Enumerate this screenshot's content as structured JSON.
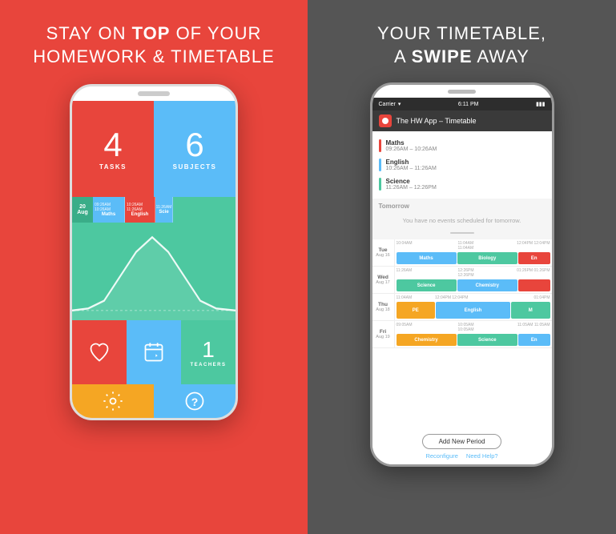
{
  "left": {
    "headline_line1": "STAY ON ",
    "headline_bold": "TOP",
    "headline_line2": " OF YOUR",
    "headline_line3": "HOMEWORK & TIMETABLE",
    "tasks_number": "4",
    "tasks_label": "TASKS",
    "subjects_number": "6",
    "subjects_label": "SUBJECTS",
    "timeline": {
      "date_day": "20",
      "date_month": "Aug",
      "items": [
        {
          "start": "09:26AM",
          "end": "10:26AM",
          "name": "Maths",
          "color": "maths"
        },
        {
          "start": "10:26AM",
          "end": "11:26AM",
          "name": "English",
          "color": "english"
        },
        {
          "start": "11:26AM",
          "end": "",
          "name": "Scie",
          "color": "science"
        }
      ]
    },
    "teachers_number": "1",
    "teachers_label": "TEACHERS"
  },
  "right": {
    "headline_line1": "YOUR TIMETABLE,",
    "headline_line2": "A ",
    "headline_bold": "SWIPE",
    "headline_line3": " AWAY",
    "status_carrier": "Carrier",
    "status_time": "6:11 PM",
    "app_title": "The HW App – Timetable",
    "timetable_items": [
      {
        "subject": "Maths",
        "time": "09:26AM – 10:26AM",
        "bar": "red"
      },
      {
        "subject": "English",
        "time": "10:26AM – 11:26AM",
        "bar": "blue"
      },
      {
        "subject": "Science",
        "time": "11:26AM – 12:26PM",
        "bar": "green"
      }
    ],
    "tomorrow_label": "Tomorrow",
    "tomorrow_text": "You have no events scheduled for tomorrow.",
    "weekly": [
      {
        "day": "Tue",
        "date": "Aug 16",
        "times": [
          "10:04AM",
          "11:04AM",
          "12:04PM",
          "12:04PM"
        ],
        "classes": [
          {
            "name": "Maths",
            "color": "blue",
            "flex": 2
          },
          {
            "name": "Biology",
            "color": "green",
            "flex": 2
          },
          {
            "name": "En",
            "color": "red",
            "flex": 1
          }
        ]
      },
      {
        "day": "Wed",
        "date": "Aug 17",
        "times": [
          "11:26AM",
          "12:26PM",
          "12:26PM",
          "01:26PM",
          "01:26PM"
        ],
        "classes": [
          {
            "name": "Science",
            "color": "green",
            "flex": 2
          },
          {
            "name": "Chemistry",
            "color": "blue",
            "flex": 2
          },
          {
            "name": "",
            "color": "red",
            "flex": 1
          }
        ]
      },
      {
        "day": "Thu",
        "date": "Aug 18",
        "times": [
          "11:04AM",
          "12:04PM",
          "12:04PM",
          "01:04PM",
          "01:04PM"
        ],
        "classes": [
          {
            "name": "PE",
            "color": "orange",
            "flex": 1
          },
          {
            "name": "English",
            "color": "blue",
            "flex": 2
          },
          {
            "name": "M",
            "color": "green",
            "flex": 1
          }
        ]
      },
      {
        "day": "Fri",
        "date": "Aug 19",
        "times": [
          "09:05AM",
          "10:05AM",
          "10:05AM",
          "11:05AM",
          "11:05AM"
        ],
        "classes": [
          {
            "name": "Chemistry",
            "color": "orange",
            "flex": 2
          },
          {
            "name": "Science",
            "color": "green",
            "flex": 2
          },
          {
            "name": "En",
            "color": "blue",
            "flex": 1
          }
        ]
      }
    ],
    "add_button": "Add New Period",
    "reconfigure": "Reconfigure",
    "need_help": "Need Help?"
  }
}
